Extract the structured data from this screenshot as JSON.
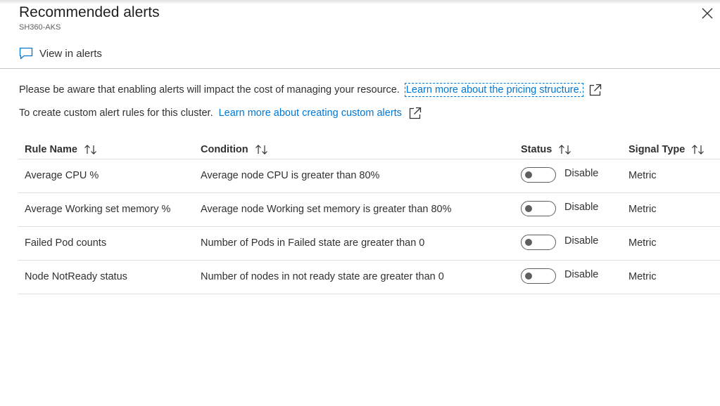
{
  "panel": {
    "title": "Recommended alerts",
    "subtitle": "SH360-AKS",
    "close_icon": "close-icon"
  },
  "toolbar": {
    "view_alerts_label": "View in alerts",
    "view_alerts_icon": "chat-bubble-icon"
  },
  "info": {
    "cost_text": "Please be aware that enabling alerts will impact the cost of managing your resource.",
    "pricing_link": "Learn more about the pricing structure.",
    "custom_text": "To create custom alert rules for this cluster.",
    "custom_link": "Learn more about creating custom alerts",
    "external_icon": "external-link-icon"
  },
  "table": {
    "headers": {
      "rule_name": "Rule Name",
      "condition": "Condition",
      "status": "Status",
      "signal_type": "Signal Type"
    },
    "sort_icon": "sort-icon",
    "rows": [
      {
        "rule_name": "Average CPU %",
        "condition": "Average node CPU is greater than 80%",
        "status": "Disable",
        "enabled": false,
        "signal_type": "Metric"
      },
      {
        "rule_name": "Average Working set memory %",
        "condition": "Average node Working set memory is greater than 80%",
        "status": "Disable",
        "enabled": false,
        "signal_type": "Metric"
      },
      {
        "rule_name": "Failed Pod counts",
        "condition": "Number of Pods in Failed state are greater than 0",
        "status": "Disable",
        "enabled": false,
        "signal_type": "Metric"
      },
      {
        "rule_name": "Node NotReady status",
        "condition": "Number of nodes in not ready state are greater than 0",
        "status": "Disable",
        "enabled": false,
        "signal_type": "Metric"
      }
    ]
  },
  "colors": {
    "link": "#0078d4",
    "text": "#323130",
    "divider": "#c8c6c4"
  }
}
